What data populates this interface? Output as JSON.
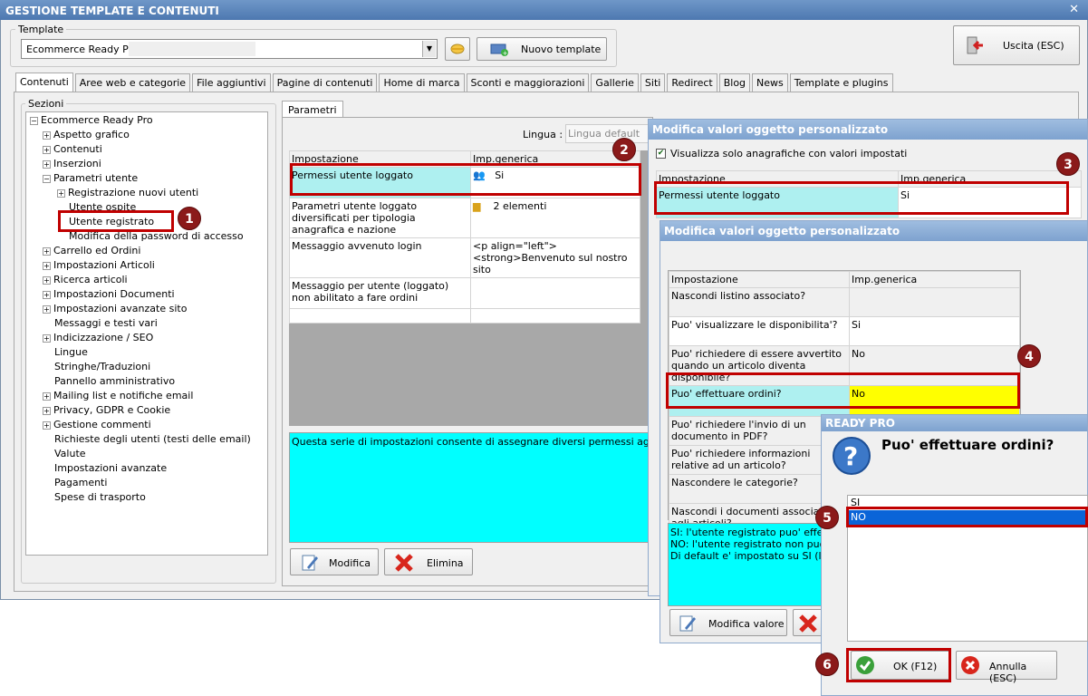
{
  "title": "GESTIONE TEMPLATE E CONTENUTI",
  "template_group": {
    "label": "Template",
    "selected": "Ecommerce Ready Pro",
    "new_button": "Nuovo template",
    "exit_button": "Uscita (ESC)"
  },
  "tabs": [
    "Contenuti",
    "Aree web e categorie",
    "File aggiuntivi",
    "Pagine di contenuti",
    "Home di marca",
    "Sconti e maggiorazioni",
    "Gallerie",
    "Siti",
    "Redirect",
    "Blog",
    "News",
    "Template e plugins"
  ],
  "sections": {
    "label": "Sezioni",
    "root": "Ecommerce Ready Pro",
    "items": [
      "Aspetto grafico",
      "Contenuti",
      "Inserzioni",
      "Parametri utente",
      "Registrazione nuovi utenti",
      "Utente ospite",
      "Utente registrato",
      "Modifica della password di accesso",
      "Carrello ed Ordini",
      "Impostazioni Articoli",
      "Ricerca articoli",
      "Impostazioni Documenti",
      "Impostazioni avanzate sito",
      "Messaggi e testi vari",
      "Indicizzazione / SEO",
      "Lingue",
      "Stringhe/Traduzioni",
      "Pannello amministrativo",
      "Mailing list e notifiche email",
      "Privacy, GDPR e Cookie",
      "Gestione commenti",
      "Richieste degli utenti (testi delle email)",
      "Valute",
      "Impostazioni avanzate",
      "Pagamenti",
      "Spese di trasporto"
    ]
  },
  "params": {
    "tab": "Parametri",
    "lingua_label": "Lingua :",
    "lingua_placeholder": "Lingua default",
    "col_setting": "Impostazione",
    "col_value": "Imp.generica",
    "rows": [
      {
        "setting": "Permessi utente loggato",
        "value": "Si"
      },
      {
        "setting": "Parametri utente loggato diversificati per tipologia anagrafica e nazione",
        "value": "2 elementi"
      },
      {
        "setting": "Messaggio avvenuto login",
        "value": "<p align=\"left\"><strong>Benvenuto sul nostro sito"
      },
      {
        "setting": "Messaggio per utente (loggato) non abilitato a fare ordini",
        "value": ""
      }
    ],
    "description": "Questa serie di impostazioni consente di assegnare diversi permessi agli utenti (dop",
    "edit_button": "Modifica",
    "delete_button": "Elimina"
  },
  "win2": {
    "title": "Modifica valori oggetto personalizzato",
    "checkbox_label": "Visualizza solo anagrafiche con valori impostati",
    "col_setting": "Impostazione",
    "col_value": "Imp.generica",
    "row_setting": "Permessi utente loggato",
    "row_value": "Si"
  },
  "win3": {
    "title": "Modifica valori oggetto personalizzato",
    "col_setting": "Impostazione",
    "col_value": "Imp.generica",
    "rows": [
      {
        "setting": "Nascondi listino associato?",
        "value": ""
      },
      {
        "setting": "Puo' visualizzare le disponibilita'?",
        "value": "Si"
      },
      {
        "setting": "Puo' richiedere di essere avvertito quando un articolo diventa disponibile?",
        "value": "No"
      },
      {
        "setting": "Puo' effettuare ordini?",
        "value": "No"
      },
      {
        "setting": "Puo' richiedere l'invio di un documento in PDF?",
        "value": ""
      },
      {
        "setting": "Puo' richiedere informazioni relative ad un articolo?",
        "value": ""
      },
      {
        "setting": "Nascondere le categorie?",
        "value": ""
      },
      {
        "setting": "Nascondi i documenti associati agli articoli?",
        "value": ""
      }
    ],
    "description_lines": [
      "SI: l'utente registrato puo' effettua",
      "NO: l'utente registrato non puo' effe",
      "Di default e' impostato su SI (l'uten"
    ],
    "edit_button": "Modifica valore"
  },
  "dialog": {
    "title": "READY PRO",
    "question": "Puo' effettuare ordini?",
    "options": [
      "SI",
      "NO"
    ],
    "selected": "NO",
    "ok_button": "OK (F12)",
    "cancel_button": "Annulla (ESC)"
  },
  "badges": [
    "1",
    "2",
    "3",
    "4",
    "5",
    "6"
  ],
  "colors": {
    "title_bar": "#4d78b0",
    "highlight_cyan": "#aef0f0",
    "description_bg": "#00ffff",
    "selected_yellow": "#ffff00",
    "list_selected": "#0a64d8",
    "annotation_red": "#c00000"
  }
}
